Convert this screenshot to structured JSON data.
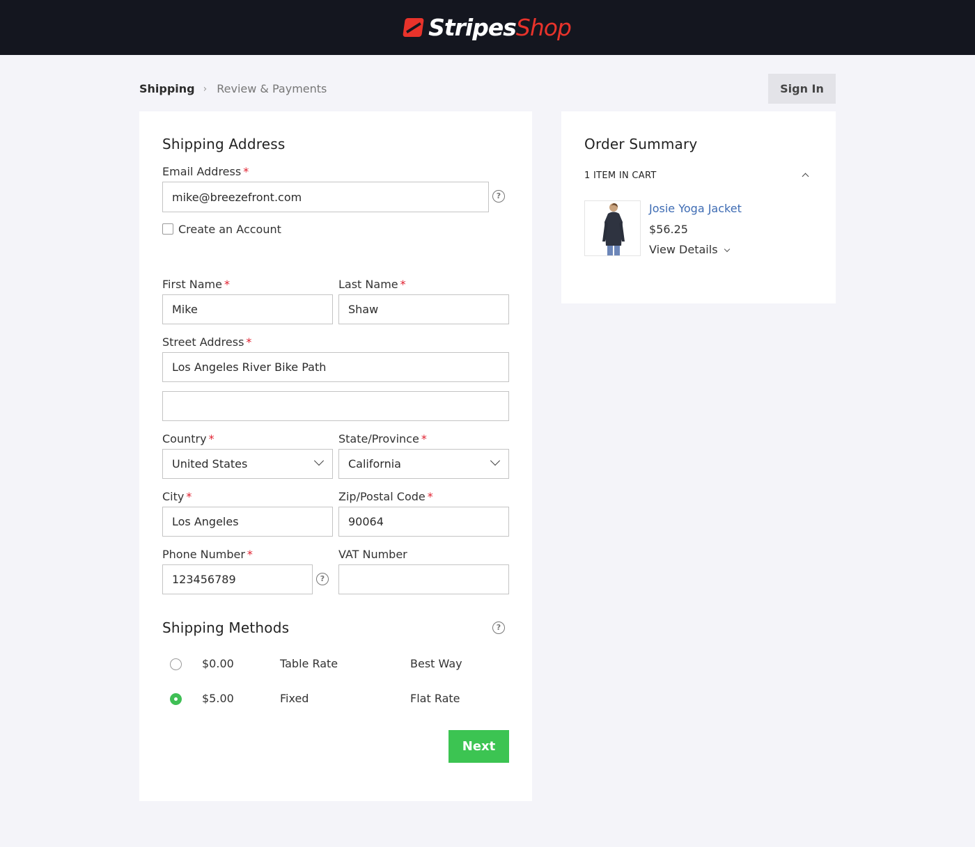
{
  "header": {
    "logo_part1": "Stripes",
    "logo_part2": "Shop",
    "brand_color": "#e8332b"
  },
  "breadcrumb": {
    "current": "Shipping",
    "separator": "›",
    "next": "Review & Payments"
  },
  "auth": {
    "sign_in_label": "Sign In"
  },
  "shipping": {
    "title": "Shipping Address",
    "email": {
      "label": "Email Address",
      "value": "mike@breezefront.com",
      "help": "?"
    },
    "create_account_label": "Create an Account",
    "create_account_checked": false,
    "first_name": {
      "label": "First Name",
      "value": "Mike"
    },
    "last_name": {
      "label": "Last Name",
      "value": "Shaw"
    },
    "street": {
      "label": "Street Address",
      "line1": "Los Angeles River Bike Path",
      "line2": ""
    },
    "country": {
      "label": "Country",
      "value": "United States"
    },
    "state": {
      "label": "State/Province",
      "value": "California"
    },
    "city": {
      "label": "City",
      "value": "Los Angeles"
    },
    "zip": {
      "label": "Zip/Postal Code",
      "value": "90064"
    },
    "phone": {
      "label": "Phone Number",
      "value": "123456789",
      "help": "?"
    },
    "vat": {
      "label": "VAT Number",
      "value": ""
    },
    "required_mark": "*"
  },
  "methods": {
    "title": "Shipping Methods",
    "help": "?",
    "options": [
      {
        "price": "$0.00",
        "method": "Table Rate",
        "carrier": "Best Way",
        "selected": false
      },
      {
        "price": "$5.00",
        "method": "Fixed",
        "carrier": "Flat Rate",
        "selected": true
      }
    ],
    "next_label": "Next",
    "accent_color": "#3cc452"
  },
  "summary": {
    "title": "Order Summary",
    "cart_count": "1 ITEM IN CART",
    "item": {
      "name": "Josie Yoga Jacket",
      "price": "$56.25",
      "details_label": "View Details"
    }
  }
}
